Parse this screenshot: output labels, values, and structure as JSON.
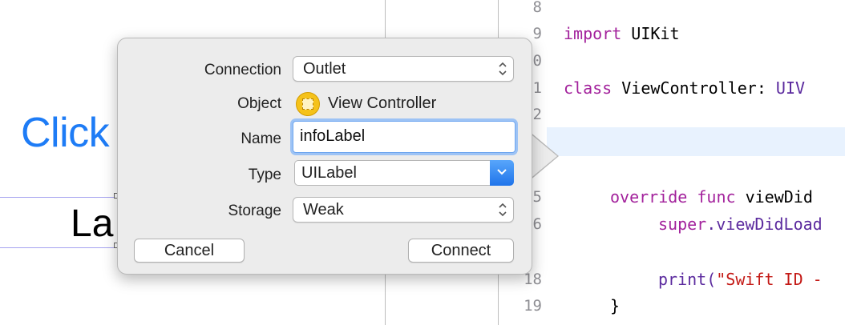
{
  "canvas": {
    "button_text": "Click",
    "label_text": "La"
  },
  "popover": {
    "rows": {
      "connection": {
        "label": "Connection",
        "value": "Outlet"
      },
      "object": {
        "label": "Object",
        "value": "View Controller",
        "icon": "view-controller-icon"
      },
      "name": {
        "label": "Name",
        "value": "infoLabel"
      },
      "type": {
        "label": "Type",
        "value": "UILabel"
      },
      "storage": {
        "label": "Storage",
        "value": "Weak"
      }
    },
    "cancel_label": "Cancel",
    "connect_label": "Connect"
  },
  "editor": {
    "lines": [
      {
        "no": "8",
        "code": ""
      },
      {
        "no": "9",
        "kw": "import",
        "rest": " UIKit"
      },
      {
        "no": "0"
      },
      {
        "no": "1",
        "kw": "class",
        "rest": " ViewController: ",
        "cls": "UIV"
      },
      {
        "no": "2"
      },
      {
        "no": "5",
        "kw": "override func",
        "rest": " viewDid"
      },
      {
        "no": "6",
        "kw": "super",
        "rest": ".viewDidLoad"
      },
      {
        "no": "18",
        "fn": "print(",
        "str": "\"Swift ID -"
      },
      {
        "no": "19",
        "rest": "}"
      }
    ]
  },
  "colors": {
    "accent": "#1e7cf6",
    "keyword": "#a3229c",
    "string": "#c41a16",
    "popover_bg": "#ececec"
  }
}
